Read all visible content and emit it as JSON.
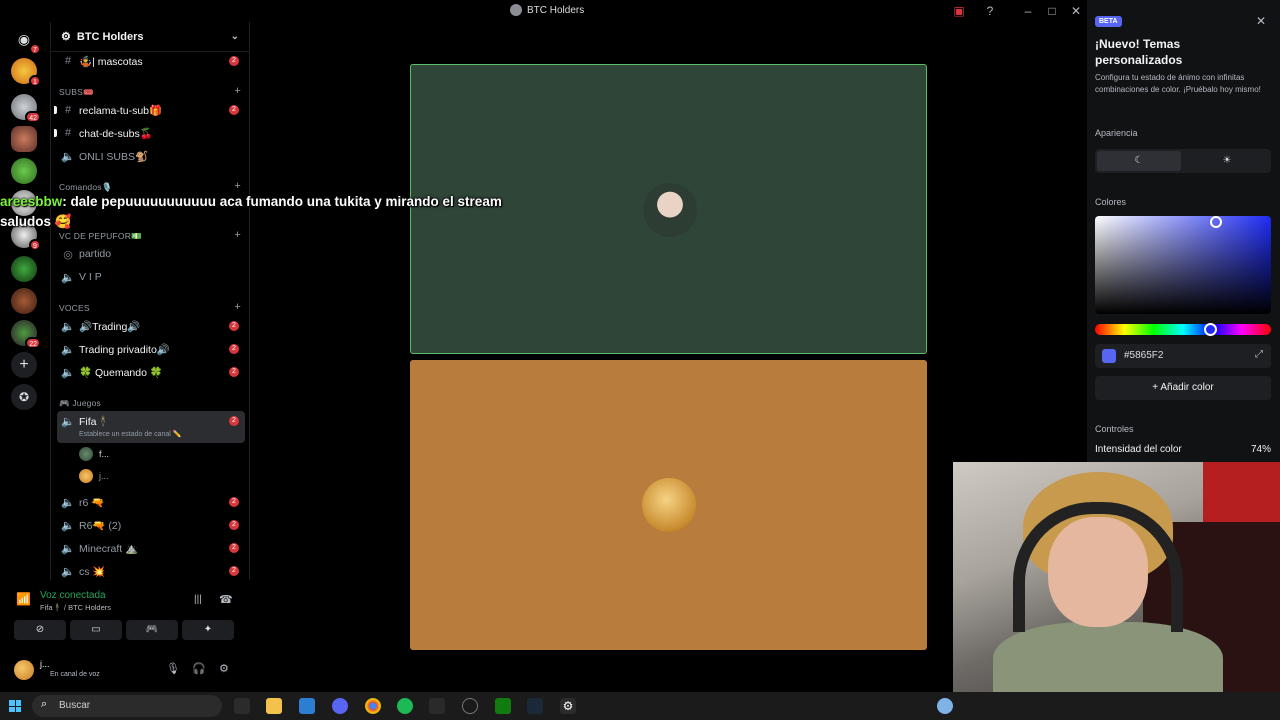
{
  "window": {
    "title": "BTC Holders"
  },
  "server": {
    "name": "BTC Holders"
  },
  "rail_badges": [
    "7",
    "1",
    "42",
    "9",
    "22"
  ],
  "channels": {
    "top": [
      {
        "name": "🤹| mascotas",
        "count": "2"
      }
    ],
    "categories": [
      {
        "label": "SUBS🎟️",
        "items": [
          {
            "name": "reclama-tu-sub🎁",
            "count": "2"
          },
          {
            "name": "chat-de-subs🍒",
            "count": "2"
          },
          {
            "name": "ONLI SUBS🐒",
            "count": ""
          }
        ]
      },
      {
        "label": "Comandos🎙️",
        "items": []
      },
      {
        "label": "VC DE PEPUFOR💵",
        "items": [
          {
            "name": "partido",
            "count": ""
          },
          {
            "name": "V I P",
            "count": ""
          }
        ]
      },
      {
        "label": "VOCES",
        "items": [
          {
            "name": "🔊Trading🔊",
            "count": "2"
          },
          {
            "name": "Trading privadito🔊",
            "count": "2"
          },
          {
            "name": "🍀 Quemando 🍀",
            "count": "2"
          }
        ]
      },
      {
        "label": "🎮 Juegos",
        "items": [
          {
            "name": "Fifa🕴️",
            "count": "2",
            "status": "Establece un estado de canal ✏️"
          },
          {
            "name": "r6 🔫",
            "count": "2"
          },
          {
            "name": "R6🔫 (2)",
            "count": "2"
          },
          {
            "name": "Minecraft ⛰️",
            "count": "2"
          },
          {
            "name": "cs 💥",
            "count": "2"
          }
        ]
      }
    ],
    "voice_users": [
      "f...",
      "j..."
    ]
  },
  "voice_panel": {
    "title": "Voz conectada",
    "subtitle": "Fifa🕴️ / BTC Holders"
  },
  "user_panel": {
    "name": "j...",
    "status": "En canal de voz"
  },
  "chat_overlay": {
    "username": "areesbbw",
    "message": ": dale pepuuuuuuuuuuu aca fumando una tukita y mirando el stream",
    "line2": "saludos 🥰"
  },
  "theme_panel": {
    "badge": "BETA",
    "heading": "¡Nuevo! Temas personalizados",
    "description": "Configura tu estado de ánimo con infinitas combinaciones de color. ¡Pruébalo hoy mismo!",
    "appearance_label": "Apariencia",
    "appearance_options": [
      "☾",
      "☀"
    ],
    "colors_label": "Colores",
    "hex_value": "#5865F2",
    "add_color": "+ Añadir color",
    "controls_label": "Controles",
    "intensity_label": "Intensidad del color",
    "intensity_value": "74%",
    "accent": "#5865f2"
  },
  "taskbar": {
    "search_placeholder": "Buscar"
  }
}
